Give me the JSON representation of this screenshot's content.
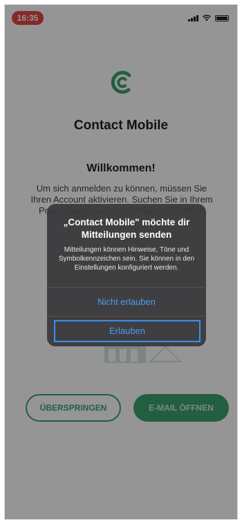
{
  "status_bar": {
    "time": "16:35",
    "icons": [
      "signal-icon",
      "wifi-icon",
      "battery-icon"
    ]
  },
  "colors": {
    "brand_green": "#2e9c64",
    "time_pill": "#e5393a",
    "alert_link": "#4a9cf5"
  },
  "app": {
    "logo": "app-logo",
    "name": "Contact Mobile"
  },
  "welcome": {
    "heading": "Willkommen!",
    "text": "Um sich anmelden zu können, müssen Sie Ihren Account aktivieren. Suchen Sie in Ihrem Posteingang nach der E-Mail von Contact Mobile."
  },
  "illustration": "envelope-illustration",
  "buttons": {
    "skip": "ÜBERSPRINGEN",
    "open_mail": "E-MAIL ÖFFNEN"
  },
  "alert": {
    "title": "„Contact Mobile\" möchte dir Mitteilungen senden",
    "message": "Mitteilungen können Hinweise, Töne und Symbolkennzeichen sein. Sie können in den Einstellungen konfiguriert werden.",
    "deny": "Nicht erlauben",
    "allow": "Erlauben"
  }
}
